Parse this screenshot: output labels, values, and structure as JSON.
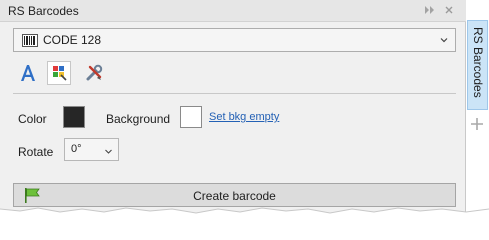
{
  "panel": {
    "title": "RS Barcodes",
    "header_buttons": [
      {
        "icon": "double-chevron-right-icon",
        "glyph": "▸▸"
      },
      {
        "icon": "close-icon",
        "glyph": "✕"
      }
    ]
  },
  "barcode_type": {
    "value": "CODE 128",
    "icon": "barcode-icon"
  },
  "toolbar": [
    {
      "icon": "text-format-icon",
      "active": false
    },
    {
      "icon": "color-palette-icon",
      "active": true
    },
    {
      "icon": "tools-icon",
      "active": false
    }
  ],
  "color_section": {
    "color_label": "Color",
    "color_value": "#262626",
    "background_label": "Background",
    "background_value": "#ffffff",
    "set_empty_link": "Set bkg empty"
  },
  "rotate": {
    "label": "Rotate",
    "value": "0°"
  },
  "create_button": {
    "label": "Create barcode",
    "icon": "green-flag-icon"
  },
  "side_tab": {
    "label": "RS Barcodes",
    "add_icon": "plus-icon"
  }
}
